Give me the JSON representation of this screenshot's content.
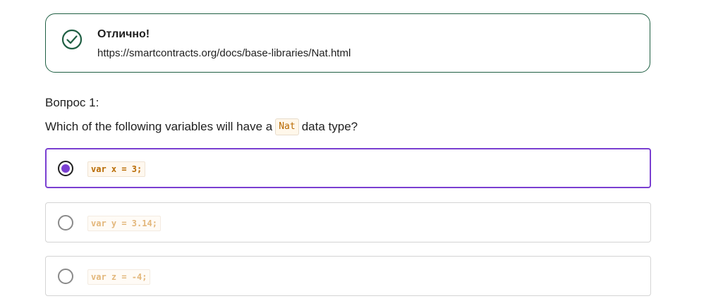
{
  "feedback": {
    "title": "Отлично!",
    "link": "https://smartcontracts.org/docs/base-libraries/Nat.html",
    "icon": "check-circle-icon",
    "accent_color": "#1f5f43"
  },
  "question": {
    "number_label": "Вопрос 1:",
    "text_before": "Which of the following variables will have a",
    "code": "Nat",
    "text_after": "data type?"
  },
  "options": [
    {
      "code": "var x = 3;",
      "selected": true
    },
    {
      "code": "var y = 3.14;",
      "selected": false
    },
    {
      "code": "var z = -4;",
      "selected": false
    }
  ],
  "colors": {
    "selected_accent": "#7a3fd1",
    "code_text": "#b86a00",
    "code_text_muted": "#e3b77b"
  }
}
